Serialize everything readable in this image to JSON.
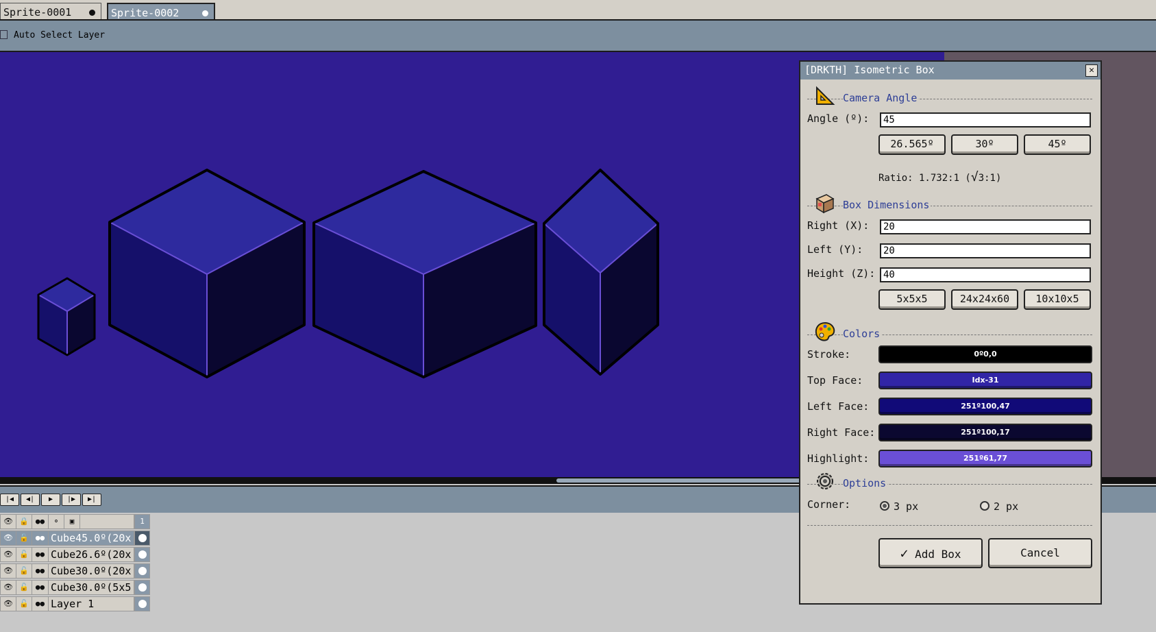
{
  "tabs": [
    {
      "label": "Sprite-0001"
    },
    {
      "label": "Sprite-0002"
    }
  ],
  "context_bar": {
    "auto_select_label": "Auto Select Layer",
    "auto_select_checked": false
  },
  "canvas": {
    "background": "#301d92",
    "stroke_color": "#000000",
    "top_face_color": "#2e2a9e",
    "left_face_color": "#15106a",
    "right_face_color": "#0a0730",
    "highlight_color": "#6a4fd6"
  },
  "timeline": {
    "nav_buttons": [
      "first-frame-icon",
      "prev-frame-icon",
      "play-icon",
      "next-frame-icon",
      "last-frame-icon"
    ],
    "header_icons": [
      "eye-icon",
      "lock-icon",
      "continuous-icon",
      "group-icon",
      "new-layer-icon"
    ],
    "frame_number": "1",
    "layers": [
      {
        "name": "Cube45.0º(20x",
        "active": true
      },
      {
        "name": "Cube26.6º(20x",
        "active": false
      },
      {
        "name": "Cube30.0º(20x",
        "active": false
      },
      {
        "name": "Cube30.0º(5x5",
        "active": false
      },
      {
        "name": "Layer 1",
        "active": false
      }
    ]
  },
  "dialog": {
    "title": "[DRKTH] Isometric Box",
    "close_symbol": "✕",
    "camera": {
      "section_title": "Camera Angle",
      "angle_label": "Angle (º):",
      "angle_value": "45",
      "presets": [
        "26.565º",
        "30º",
        "45º"
      ],
      "ratio_prefix": "Ratio: 1.732:1 (",
      "ratio_root": "√",
      "ratio_suffix": "3:1)"
    },
    "dimensions": {
      "section_title": "Box Dimensions",
      "right_label": "Right (X):",
      "right_value": "20",
      "left_label": "Left (Y):",
      "left_value": "20",
      "height_label": "Height (Z):",
      "height_value": "40",
      "presets": [
        "5x5x5",
        "24x24x60",
        "10x10x5"
      ]
    },
    "colors": {
      "section_title": "Colors",
      "items": [
        {
          "label": "Stroke:",
          "value": "0º0,0",
          "color": "#000000"
        },
        {
          "label": "Top Face:",
          "value": "Idx-31",
          "color": "#3125a6"
        },
        {
          "label": "Left Face:",
          "value": "251º100,47",
          "color": "#110a78"
        },
        {
          "label": "Right Face:",
          "value": "251º100,17",
          "color": "#0b0830"
        },
        {
          "label": "Highlight:",
          "value": "251º61,77",
          "color": "#6a4fd6"
        }
      ]
    },
    "options": {
      "section_title": "Options",
      "corner_label": "Corner:",
      "corner_options": [
        "3 px",
        "2 px"
      ],
      "corner_selected": "3 px"
    },
    "add_label": "Add Box",
    "add_check": "✓",
    "cancel_label": "Cancel"
  }
}
